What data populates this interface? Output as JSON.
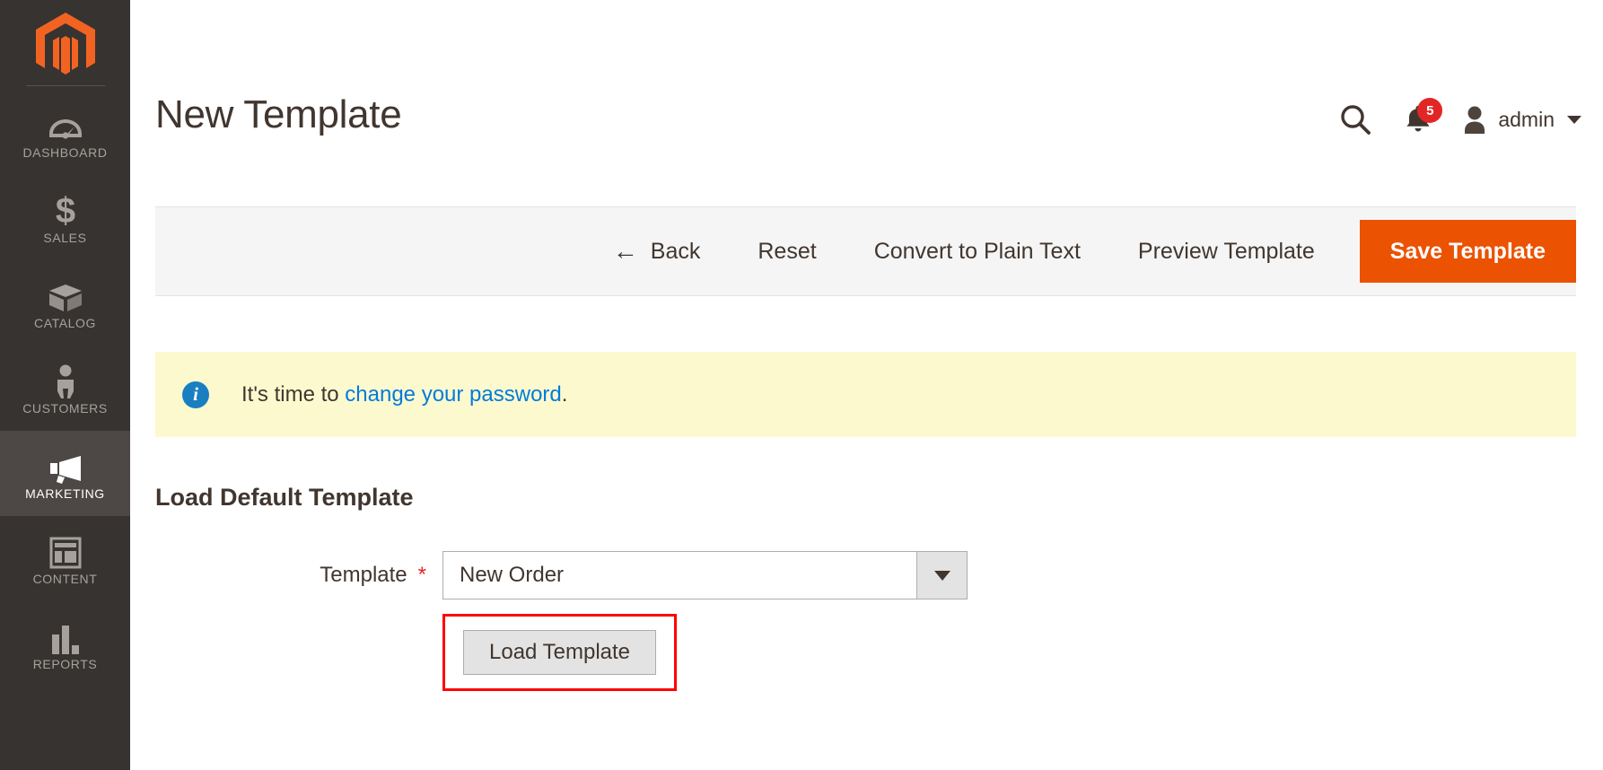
{
  "sidebar": {
    "logo_name": "magento-logo",
    "items": [
      {
        "label": "DASHBOARD",
        "icon": "dashboard-icon",
        "active": false
      },
      {
        "label": "SALES",
        "icon": "dollar-icon",
        "active": false
      },
      {
        "label": "CATALOG",
        "icon": "box-icon",
        "active": false
      },
      {
        "label": "CUSTOMERS",
        "icon": "person-icon",
        "active": false
      },
      {
        "label": "MARKETING",
        "icon": "megaphone-icon",
        "active": true
      },
      {
        "label": "CONTENT",
        "icon": "layout-icon",
        "active": false
      },
      {
        "label": "REPORTS",
        "icon": "bar-chart-icon",
        "active": false
      }
    ]
  },
  "header": {
    "title": "New Template",
    "search_icon": "search-icon",
    "notifications_icon": "bell-icon",
    "notifications_count": "5",
    "avatar_icon": "user-avatar-icon",
    "admin_label": "admin",
    "caret_icon": "chevron-down-icon"
  },
  "toolbar": {
    "back_arrow": "←",
    "back_label": "Back",
    "reset_label": "Reset",
    "convert_label": "Convert to Plain Text",
    "preview_label": "Preview Template",
    "save_label": "Save Template"
  },
  "notice": {
    "icon": "info-icon",
    "icon_glyph": "i",
    "text_before": "It's time to ",
    "link_text": "change your password",
    "text_after": "."
  },
  "section": {
    "title": "Load Default Template"
  },
  "form": {
    "template_label": "Template",
    "required_marker": "*",
    "template_value": "New Order",
    "template_options": [
      "New Order"
    ],
    "load_button_label": "Load Template"
  },
  "colors": {
    "brand_orange": "#eb5202",
    "sidebar_bg": "#373330",
    "sidebar_active_bg": "#4d4845",
    "notice_bg": "#fdf9cf",
    "link_blue": "#007bdb",
    "badge_red": "#e22626",
    "highlight_red": "#ff0000"
  }
}
